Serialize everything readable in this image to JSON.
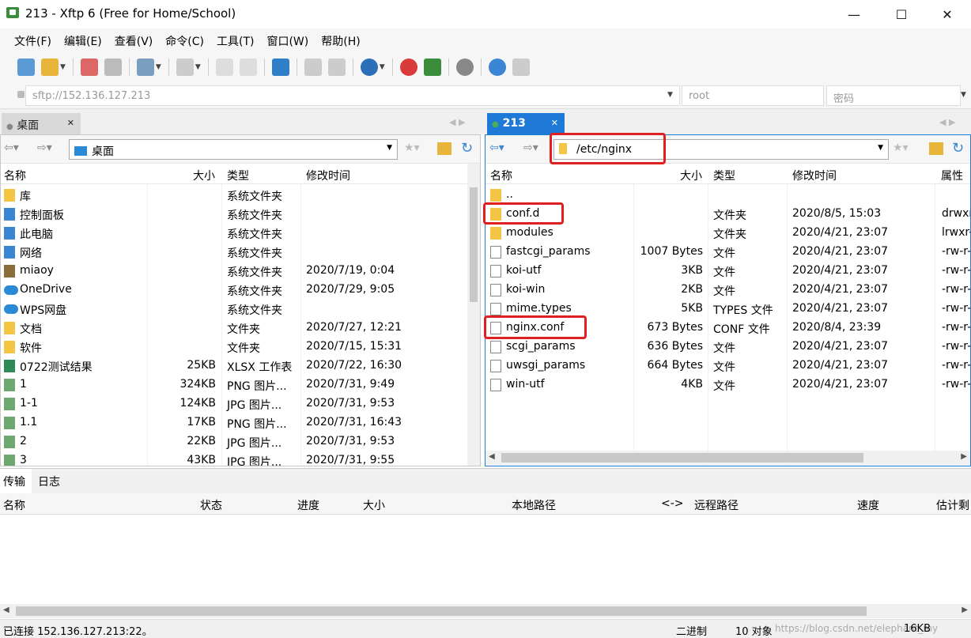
{
  "window": {
    "title": "213 - Xftp 6 (Free for Home/School)",
    "minimize": "—",
    "maximize": "☐",
    "close": "✕"
  },
  "menu": [
    "文件(F)",
    "编辑(E)",
    "查看(V)",
    "命令(C)",
    "工具(T)",
    "窗口(W)",
    "帮助(H)"
  ],
  "address": {
    "url": "sftp://152.136.127.213",
    "user_placeholder": "root",
    "password_placeholder": "密码"
  },
  "left": {
    "tab": "桌面",
    "path": "桌面",
    "columns": [
      "名称",
      "大小",
      "类型",
      "修改时间"
    ],
    "rows": [
      {
        "name": "库",
        "size": "",
        "type": "系统文件夹",
        "time": "",
        "icon": "library-icon"
      },
      {
        "name": "控制面板",
        "size": "",
        "type": "系统文件夹",
        "time": "",
        "icon": "control-panel-icon"
      },
      {
        "name": "此电脑",
        "size": "",
        "type": "系统文件夹",
        "time": "",
        "icon": "computer-icon"
      },
      {
        "name": "网络",
        "size": "",
        "type": "系统文件夹",
        "time": "",
        "icon": "network-icon"
      },
      {
        "name": "miaoy",
        "size": "",
        "type": "系统文件夹",
        "time": "2020/7/19, 0:04",
        "icon": "user-icon"
      },
      {
        "name": "OneDrive",
        "size": "",
        "type": "系统文件夹",
        "time": "2020/7/29, 9:05",
        "icon": "cloud-icon"
      },
      {
        "name": "WPS网盘",
        "size": "",
        "type": "系统文件夹",
        "time": "",
        "icon": "cloud-icon"
      },
      {
        "name": "文档",
        "size": "",
        "type": "文件夹",
        "time": "2020/7/27, 12:21",
        "icon": "folder-icon"
      },
      {
        "name": "软件",
        "size": "",
        "type": "文件夹",
        "time": "2020/7/15, 15:31",
        "icon": "folder-icon"
      },
      {
        "name": "0722测试结果",
        "size": "25KB",
        "type": "XLSX 工作表",
        "time": "2020/7/22, 16:30",
        "icon": "xlsx-icon"
      },
      {
        "name": "1",
        "size": "324KB",
        "type": "PNG 图片...",
        "time": "2020/7/31, 9:49",
        "icon": "image-icon"
      },
      {
        "name": "1-1",
        "size": "124KB",
        "type": "JPG 图片...",
        "time": "2020/7/31, 9:53",
        "icon": "image-icon"
      },
      {
        "name": "1.1",
        "size": "17KB",
        "type": "PNG 图片...",
        "time": "2020/7/31, 16:43",
        "icon": "image-icon"
      },
      {
        "name": "2",
        "size": "22KB",
        "type": "JPG 图片...",
        "time": "2020/7/31, 9:53",
        "icon": "image-icon"
      },
      {
        "name": "3",
        "size": "43KB",
        "type": "JPG 图片...",
        "time": "2020/7/31, 9:55",
        "icon": "image-icon"
      }
    ]
  },
  "right": {
    "tab": "213",
    "path": "/etc/nginx",
    "columns": [
      "名称",
      "大小",
      "类型",
      "修改时间",
      "属性"
    ],
    "rows": [
      {
        "name": "..",
        "size": "",
        "type": "",
        "time": "",
        "attr": "",
        "icon": "folder-icon"
      },
      {
        "name": "conf.d",
        "size": "",
        "type": "文件夹",
        "time": "2020/8/5, 15:03",
        "attr": "drwxr",
        "icon": "folder-icon"
      },
      {
        "name": "modules",
        "size": "",
        "type": "文件夹",
        "time": "2020/4/21, 23:07",
        "attr": "lrwxr-",
        "icon": "folder-link-icon"
      },
      {
        "name": "fastcgi_params",
        "size": "1007 Bytes",
        "type": "文件",
        "time": "2020/4/21, 23:07",
        "attr": "-rw-r-",
        "icon": "file-icon"
      },
      {
        "name": "koi-utf",
        "size": "3KB",
        "type": "文件",
        "time": "2020/4/21, 23:07",
        "attr": "-rw-r-",
        "icon": "file-icon"
      },
      {
        "name": "koi-win",
        "size": "2KB",
        "type": "文件",
        "time": "2020/4/21, 23:07",
        "attr": "-rw-r-",
        "icon": "file-icon"
      },
      {
        "name": "mime.types",
        "size": "5KB",
        "type": "TYPES 文件",
        "time": "2020/4/21, 23:07",
        "attr": "-rw-r-",
        "icon": "file-icon"
      },
      {
        "name": "nginx.conf",
        "size": "673 Bytes",
        "type": "CONF 文件",
        "time": "2020/8/4, 23:39",
        "attr": "-rw-r-",
        "icon": "file-icon"
      },
      {
        "name": "scgi_params",
        "size": "636 Bytes",
        "type": "文件",
        "time": "2020/4/21, 23:07",
        "attr": "-rw-r-",
        "icon": "file-icon"
      },
      {
        "name": "uwsgi_params",
        "size": "664 Bytes",
        "type": "文件",
        "time": "2020/4/21, 23:07",
        "attr": "-rw-r-",
        "icon": "file-icon"
      },
      {
        "name": "win-utf",
        "size": "4KB",
        "type": "文件",
        "time": "2020/4/21, 23:07",
        "attr": "-rw-r-",
        "icon": "file-icon"
      }
    ]
  },
  "bottom": {
    "tabs": [
      "传输",
      "日志"
    ],
    "columns": [
      "名称",
      "状态",
      "进度",
      "大小",
      "本地路径",
      "<->",
      "远程路径",
      "速度",
      "估计剩"
    ]
  },
  "status": {
    "left": "已连接 152.136.127.213:22。",
    "mode": "二进制",
    "count": "10 对象",
    "size": "16KB",
    "watermark": "https://blog.csdn.net/elephant_my"
  },
  "colors": {
    "highlight": "#e02020",
    "tab_active": "#1e7ad6",
    "accent": "#0078d7"
  }
}
